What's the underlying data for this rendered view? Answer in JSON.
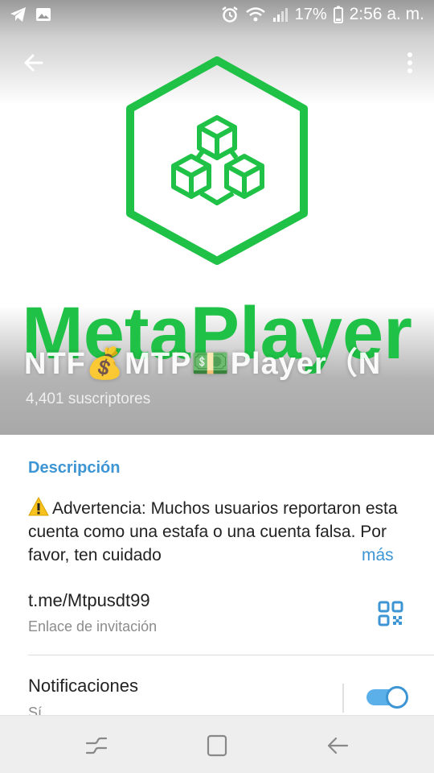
{
  "status_bar": {
    "battery_percent": "17%",
    "time": "2:56 a. m.",
    "left_icons": [
      "telegram-icon",
      "image-icon"
    ],
    "right_icons": [
      "alarm-icon",
      "wifi-icon",
      "signal-icon",
      "battery-icon"
    ]
  },
  "header": {
    "logo_text": "MetaPlayer",
    "channel_title": "NTF💰MTP💵Player（N",
    "subscribers": "4,401 suscriptores",
    "brand_color": "#1fc246"
  },
  "description": {
    "label": "Descripción",
    "text": "Advertencia: Muchos usuarios reportaron esta cuenta como una estafa o una cuenta falsa. Por favor, ten cuidado",
    "more": "más"
  },
  "invite": {
    "link": "t.me/Mtpusdt99",
    "label": "Enlace de invitación"
  },
  "notifications": {
    "label": "Notificaciones",
    "value": "Sí",
    "enabled": true
  },
  "colors": {
    "accent": "#3d95d4",
    "toggle_track": "#5cb0e9"
  }
}
